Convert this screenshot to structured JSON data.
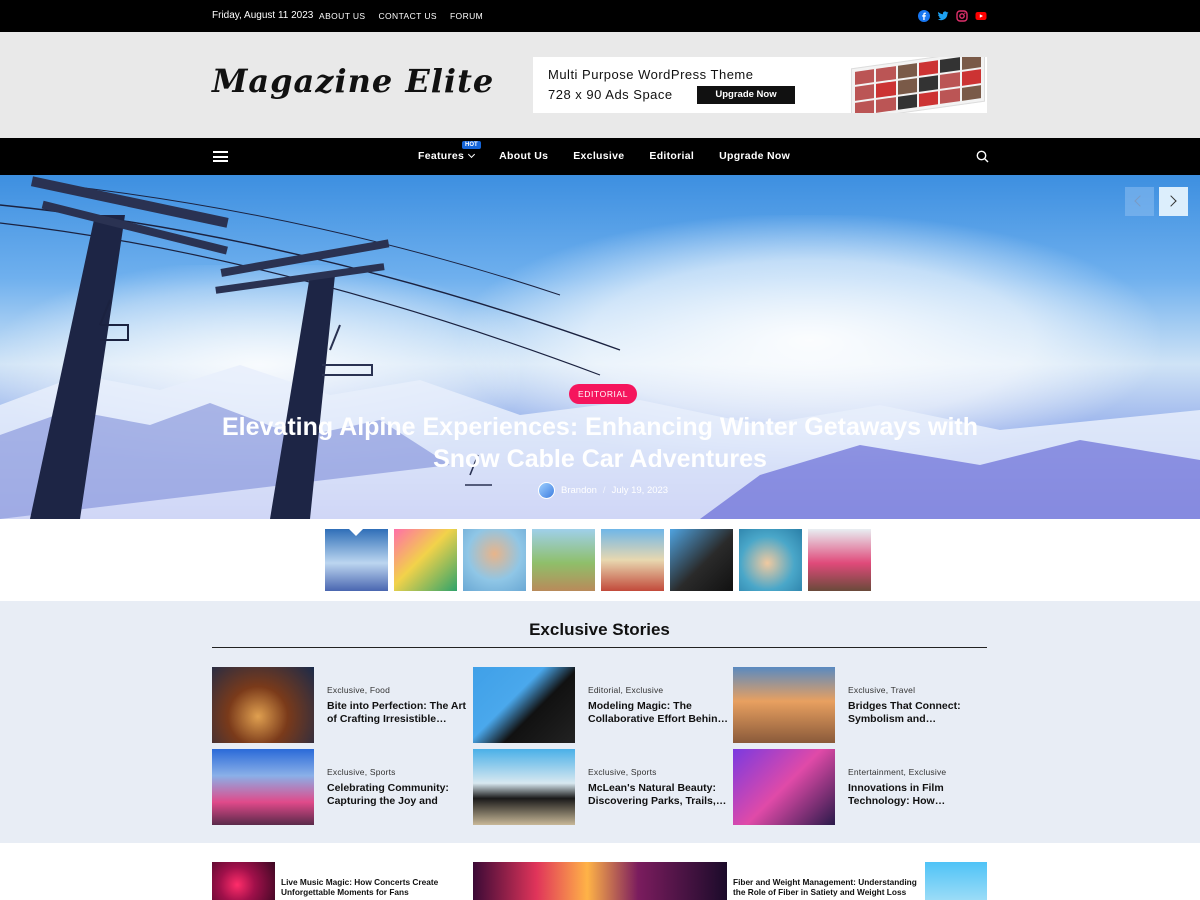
{
  "topbar": {
    "date": "Friday, August 11 2023",
    "links": [
      "ABOUT US",
      "CONTACT US",
      "FORUM"
    ],
    "social": [
      "facebook-icon",
      "twitter-icon",
      "instagram-icon",
      "youtube-icon"
    ],
    "social_colors": {
      "facebook": "#1877f2",
      "twitter": "#1da1f2",
      "instagram": "#e1306c",
      "youtube": "#ff0000"
    }
  },
  "header": {
    "logo": "Magazine Elite",
    "ad": {
      "line1": "Multi Purpose WordPress Theme",
      "line2": "728 x 90 Ads Space",
      "button": "Upgrade Now"
    }
  },
  "nav": {
    "items": [
      "Features",
      "About Us",
      "Exclusive",
      "Editorial",
      "Upgrade Now"
    ],
    "hot_badge": "HOT"
  },
  "hero": {
    "category": "EDITORIAL",
    "title": "Elevating Alpine Experiences: Enhancing Winter Getaways with Snow Cable Car Adventures",
    "author": "Brandon",
    "date": "July 19, 2023"
  },
  "exclusive": {
    "heading": "Exclusive Stories",
    "cards": [
      {
        "cats": "Exclusive, Food",
        "title": "Bite into Perfection: The Art of Crafting Irresistible…"
      },
      {
        "cats": "Editorial, Exclusive",
        "title": "Modeling Magic: The Collaborative Effort Behin…"
      },
      {
        "cats": "Exclusive, Travel",
        "title": "Bridges That Connect: Symbolism and…"
      },
      {
        "cats": "Exclusive, Sports",
        "title": "Celebrating Community: Capturing the Joy and Spir…"
      },
      {
        "cats": "Exclusive, Sports",
        "title": "McLean's Natural Beauty: Discovering Parks, Trails,…"
      },
      {
        "cats": "Entertainment, Exclusive",
        "title": "Innovations in Film Technology: How…"
      }
    ]
  },
  "bottom": {
    "left_title": "Live Music Magic: How Concerts Create Unforgettable Moments for Fans",
    "right_title": "Fiber and Weight Management: Understanding the Role of Fiber in Satiety and Weight Loss"
  },
  "colors": {
    "accent": "#f5155d",
    "hot": "#1565d8",
    "section_bg": "#e8edf5"
  }
}
